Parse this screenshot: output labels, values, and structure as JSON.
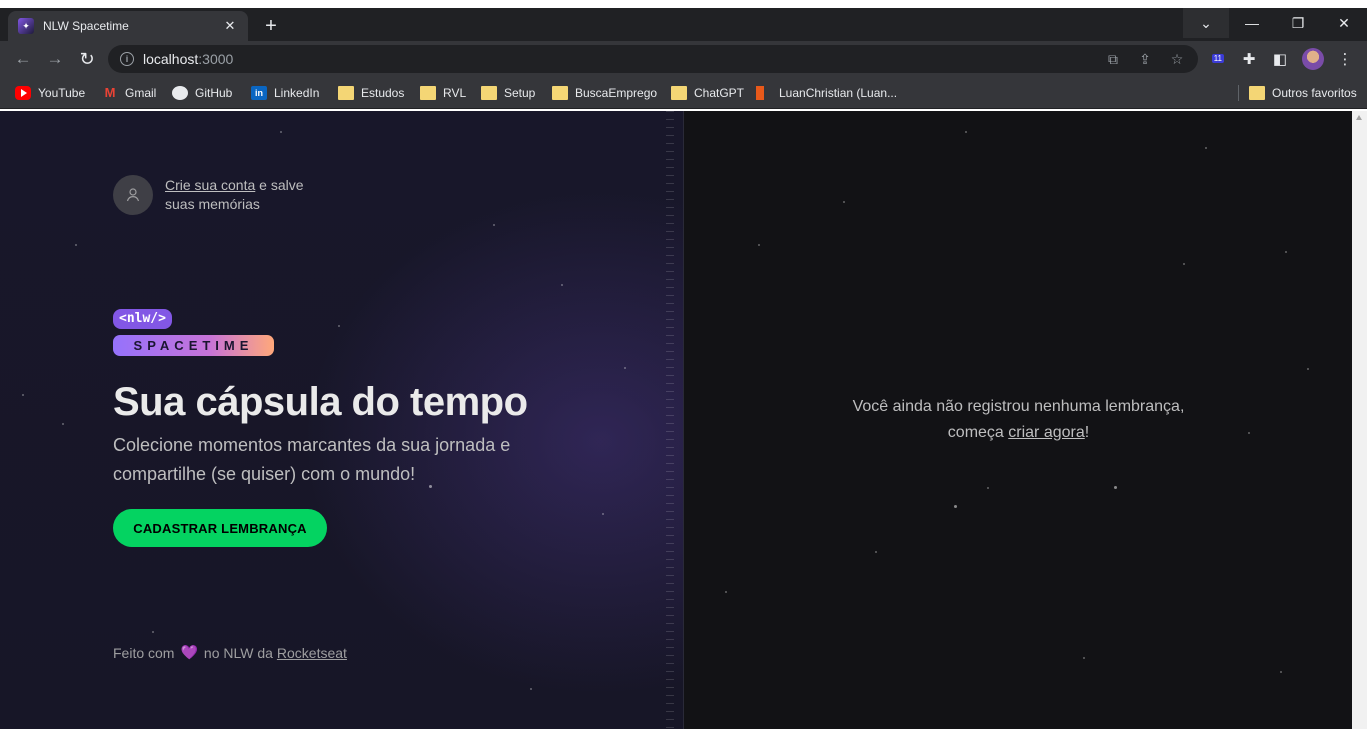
{
  "browser": {
    "tab_title": "NLW Spacetime",
    "url_host": "localhost",
    "url_port": ":3000",
    "bookmarks": [
      {
        "label": "YouTube",
        "icon": "youtube-icon"
      },
      {
        "label": "Gmail",
        "icon": "gmail-icon"
      },
      {
        "label": "GitHub",
        "icon": "github-icon"
      },
      {
        "label": "LinkedIn",
        "icon": "linkedin-icon"
      },
      {
        "label": "Estudos",
        "icon": "folder-icon"
      },
      {
        "label": "RVL",
        "icon": "folder-icon"
      },
      {
        "label": "Setup",
        "icon": "folder-icon"
      },
      {
        "label": "BuscaEmprego",
        "icon": "folder-icon"
      },
      {
        "label": "ChatGPT",
        "icon": "folder-icon"
      },
      {
        "label": "LuanChristian (Luan...",
        "icon": "luanchristian-icon"
      }
    ],
    "other_bookmarks": "Outros favoritos",
    "extension_badge": "11"
  },
  "page": {
    "signin": {
      "link": "Crie sua conta",
      "text_after": " e salve",
      "text_line2": "suas memórias"
    },
    "logo": {
      "top": "<nlw/>",
      "bottom": "SPACETIME"
    },
    "headline": "Sua cápsula do tempo",
    "lead": "Colecione momentos marcantes da sua jornada e compartilhe (se quiser) com o mundo!",
    "cta": "CADASTRAR LEMBRANÇA",
    "footer": {
      "prefix": "Feito com",
      "middle": "no NLW da",
      "link": "Rocketseat"
    },
    "empty": {
      "line1": "Você ainda não registrou nenhuma lembrança,",
      "line2_prefix": "começa ",
      "link": "criar agora",
      "suffix": "!"
    }
  },
  "colors": {
    "accent_green": "#04d361",
    "accent_purple": "#8257e5",
    "background": "#121215"
  }
}
